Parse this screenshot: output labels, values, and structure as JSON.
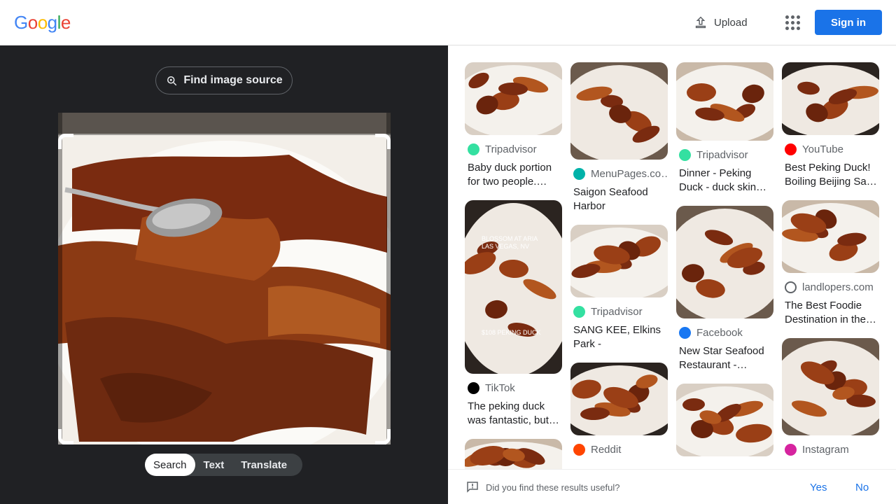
{
  "header": {
    "logo_letters": [
      "G",
      "o",
      "o",
      "g",
      "l",
      "e"
    ],
    "logo_colors": [
      "#4285f4",
      "#ea4335",
      "#fbbc05",
      "#4285f4",
      "#34a853",
      "#ea4335"
    ],
    "upload_label": "Upload",
    "apps_icon": "apps-grid-icon",
    "signin_label": "Sign in"
  },
  "left": {
    "find_source_label": "Find image source",
    "tabs": [
      {
        "label": "Search",
        "active": true
      },
      {
        "label": "Text",
        "active": false
      },
      {
        "label": "Translate",
        "active": false
      }
    ]
  },
  "results": {
    "columns": [
      [
        {
          "source": "Tripadvisor",
          "icon": "tripadvisor-icon",
          "icon_color": "#34e0a1",
          "title": "Baby duck portion for two people.…",
          "thumb_h": 104
        },
        {
          "source": "TikTok",
          "icon": "tiktok-icon",
          "icon_color": "#000000",
          "title": "The peking duck was fantastic, but…",
          "thumb_h": 248,
          "overlay_top": "BLOSSOM AT ARIA LAS VEGAS, NV",
          "overlay_bottom": "$108 PEKING DUCK"
        },
        {
          "source": "",
          "icon": "",
          "icon_color": "",
          "title": "",
          "thumb_h": 60
        }
      ],
      [
        {
          "source": "MenuPages.co…",
          "icon": "menupages-icon",
          "icon_color": "#00b2a9",
          "title": "Saigon Seafood Harbor Restauran…",
          "thumb_h": 139
        },
        {
          "source": "Tripadvisor",
          "icon": "tripadvisor-icon",
          "icon_color": "#34e0a1",
          "title": "SANG KEE, Elkins Park - Restaurant…",
          "thumb_h": 104
        },
        {
          "source": "Reddit",
          "icon": "reddit-icon",
          "icon_color": "#ff4500",
          "title": "",
          "thumb_h": 104
        }
      ],
      [
        {
          "source": "Tripadvisor",
          "icon": "tripadvisor-icon",
          "icon_color": "#34e0a1",
          "title": "Dinner - Peking Duck - duck skin…",
          "thumb_h": 112
        },
        {
          "source": "Facebook",
          "icon": "facebook-icon",
          "icon_color": "#1877f2",
          "title": "New Star Seafood Restaurant -…",
          "thumb_h": 161
        },
        {
          "source": "",
          "icon": "",
          "icon_color": "",
          "title": "",
          "thumb_h": 104
        }
      ],
      [
        {
          "source": "YouTube",
          "icon": "youtube-icon",
          "icon_color": "#ff0000",
          "title": "Best Peking Duck! Boiling Beijing Sa…",
          "thumb_h": 104
        },
        {
          "source": "landlopers.com",
          "icon": "landlopers-icon",
          "icon_color": "#ffffff",
          "title": "The Best Foodie Destination in the…",
          "thumb_h": 104
        },
        {
          "source": "Instagram",
          "icon": "instagram-icon",
          "icon_color": "#d6249f",
          "title": "",
          "thumb_h": 139
        }
      ]
    ]
  },
  "feedback": {
    "question": "Did you find these results useful?",
    "yes": "Yes",
    "no": "No"
  }
}
